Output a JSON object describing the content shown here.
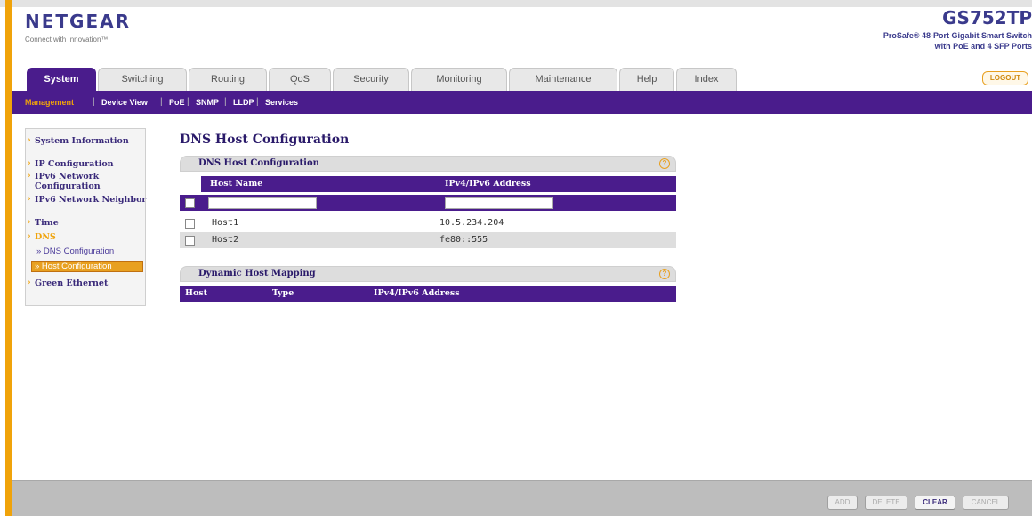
{
  "header": {
    "brand": "NETGEAR",
    "tagline": "Connect with Innovation™",
    "model": "GS752TP",
    "model_desc_line1": "ProSafe® 48-Port Gigabit Smart Switch",
    "model_desc_line2": "with PoE and 4 SFP Ports"
  },
  "tabs": [
    "System",
    "Switching",
    "Routing",
    "QoS",
    "Security",
    "Monitoring",
    "Maintenance",
    "Help",
    "Index"
  ],
  "active_tab": "System",
  "logout_label": "LOGOUT",
  "subnav": [
    "Management",
    "Device View",
    "PoE",
    "SNMP",
    "LLDP",
    "Services"
  ],
  "sidebar": {
    "items": [
      "System Information",
      "IP Configuration",
      "IPv6 Network Configuration",
      "IPv6 Network Neighbor",
      "Time",
      "DNS",
      "Green Ethernet"
    ],
    "sub_items": [
      "» DNS Configuration",
      "» Host Configuration"
    ]
  },
  "page_title": "DNS Host Configuration",
  "host_panel": {
    "title": "DNS Host Configuration",
    "help": "?",
    "columns": [
      "Host Name",
      "IPv4/IPv6 Address"
    ],
    "input_host_name": "",
    "input_address": "",
    "rows": [
      {
        "host": "Host1",
        "address": "10.5.234.204"
      },
      {
        "host": "Host2",
        "address": "fe80::555"
      }
    ]
  },
  "mapping_panel": {
    "title": "Dynamic Host Mapping",
    "help": "?",
    "columns": [
      "Host",
      "Type",
      "IPv4/IPv6 Address"
    ]
  },
  "footer_buttons": [
    "ADD",
    "DELETE",
    "CLEAR",
    "CANCEL"
  ],
  "colors": {
    "brand_purple": "#4a1c8c",
    "accent_orange": "#f0a30a"
  }
}
